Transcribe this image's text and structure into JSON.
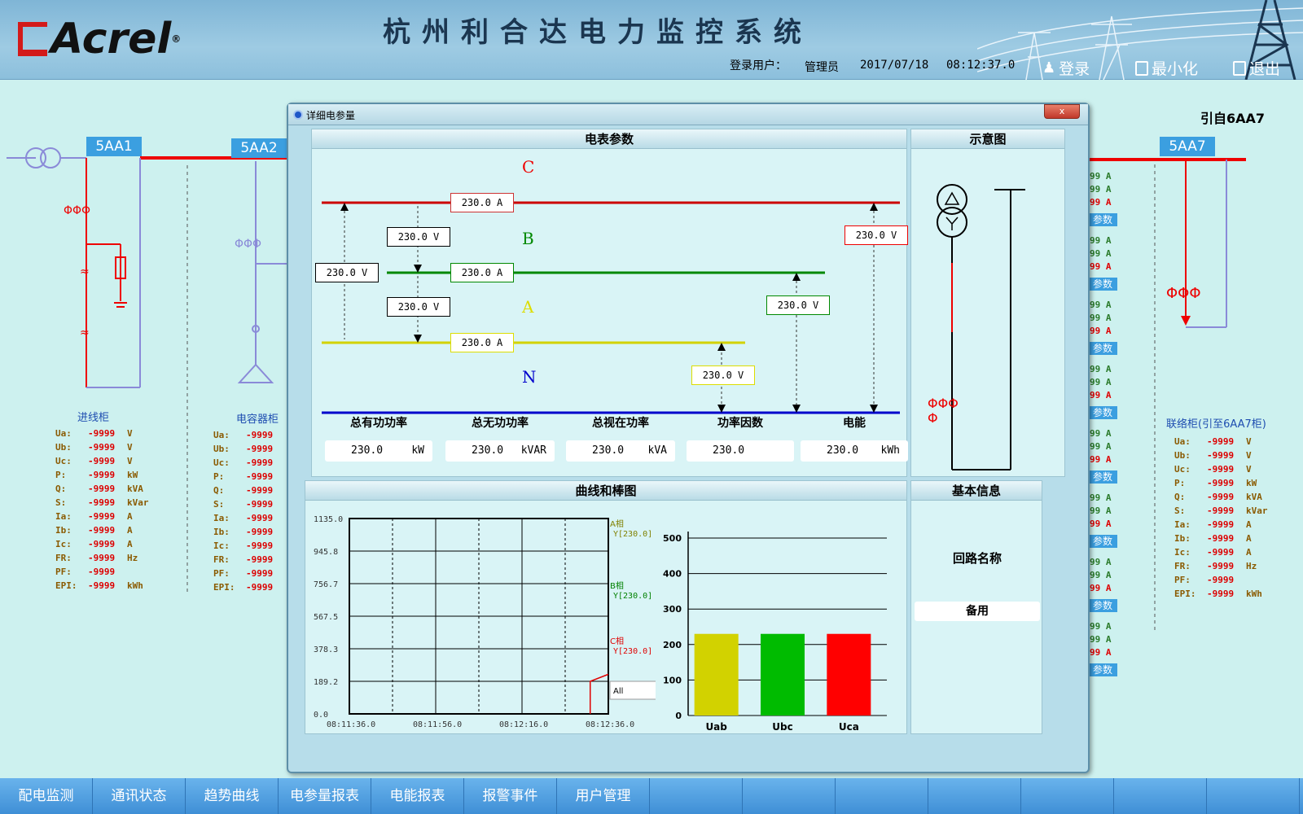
{
  "header": {
    "title": "杭州利合达电力监控系统",
    "brand": "Acrel",
    "login_user_label": "登录用户：",
    "login_user": "管理员",
    "date": "2017/07/18",
    "time": "08:12:37.0",
    "login_btn": "登录",
    "minimize_btn": "最小化",
    "exit_btn": "退出"
  },
  "left": {
    "tag1": "5AA1",
    "tag2": "5AA2",
    "cab1_label": "进线柜",
    "cab2_label": "电容器柜",
    "params1": [
      {
        "k": "Ua:",
        "v": "-9999",
        "u": "V"
      },
      {
        "k": "Ub:",
        "v": "-9999",
        "u": "V"
      },
      {
        "k": "Uc:",
        "v": "-9999",
        "u": "V"
      },
      {
        "k": "P:",
        "v": "-9999",
        "u": "kW"
      },
      {
        "k": "Q:",
        "v": "-9999",
        "u": "kVA"
      },
      {
        "k": "S:",
        "v": "-9999",
        "u": "kVar"
      },
      {
        "k": "Ia:",
        "v": "-9999",
        "u": "A"
      },
      {
        "k": "Ib:",
        "v": "-9999",
        "u": "A"
      },
      {
        "k": "Ic:",
        "v": "-9999",
        "u": "A"
      },
      {
        "k": "FR:",
        "v": "-9999",
        "u": "Hz"
      },
      {
        "k": "PF:",
        "v": "-9999",
        "u": ""
      },
      {
        "k": "EPI:",
        "v": "-9999",
        "u": "kWh"
      }
    ],
    "params2": [
      {
        "k": "Ua:",
        "v": "-9999"
      },
      {
        "k": "Ub:",
        "v": "-9999"
      },
      {
        "k": "Uc:",
        "v": "-9999"
      },
      {
        "k": "P:",
        "v": "-9999"
      },
      {
        "k": "Q:",
        "v": "-9999"
      },
      {
        "k": "S:",
        "v": "-9999"
      },
      {
        "k": "Ia:",
        "v": "-9999"
      },
      {
        "k": "Ib:",
        "v": "-9999"
      },
      {
        "k": "Ic:",
        "v": "-9999"
      },
      {
        "k": "FR:",
        "v": "-9999"
      },
      {
        "k": "PF:",
        "v": "-9999"
      },
      {
        "k": "EPI:",
        "v": "-9999"
      }
    ]
  },
  "right": {
    "source": "引自6AA7",
    "tag": "5AA7",
    "cab_label": "联络柜(引至6AA7柜)",
    "params": [
      {
        "k": "Ua:",
        "v": "-9999",
        "u": "V"
      },
      {
        "k": "Ub:",
        "v": "-9999",
        "u": "V"
      },
      {
        "k": "Uc:",
        "v": "-9999",
        "u": "V"
      },
      {
        "k": "P:",
        "v": "-9999",
        "u": "kW"
      },
      {
        "k": "Q:",
        "v": "-9999",
        "u": "kVA"
      },
      {
        "k": "S:",
        "v": "-9999",
        "u": "kVar"
      },
      {
        "k": "Ia:",
        "v": "-9999",
        "u": "A"
      },
      {
        "k": "Ib:",
        "v": "-9999",
        "u": "A"
      },
      {
        "k": "Ic:",
        "v": "-9999",
        "u": "A"
      },
      {
        "k": "FR:",
        "v": "-9999",
        "u": "Hz"
      },
      {
        "k": "PF:",
        "v": "-9999",
        "u": ""
      },
      {
        "k": "EPI:",
        "v": "-9999",
        "u": "kWh"
      }
    ],
    "strip_value": "99",
    "strip_unit": "A",
    "strip_btn": "参数"
  },
  "dialog": {
    "title": "详细电参量",
    "close": "x",
    "meter_panel": "电表参数",
    "schematic_panel": "示意图",
    "curve_panel": "曲线和棒图",
    "info_panel": "基本信息",
    "phase_c": "C",
    "phase_b": "B",
    "phase_a": "A",
    "phase_n": "N",
    "ic": "230.0  A",
    "ib": "230.0  A",
    "ia": "230.0  A",
    "uca_left": "230.0  V",
    "ubc_top": "230.0  V",
    "uab_mid": "230.0  V",
    "ucn": "230.0  V",
    "ubn": "230.0  V",
    "uan": "230.0  V",
    "sum_labels": [
      "总有功功率",
      "总无功功率",
      "总视在功率",
      "功率因数",
      "电能"
    ],
    "sum_values": [
      "230.0",
      "230.0",
      "230.0",
      "230.0",
      "230.0"
    ],
    "sum_units": [
      "kW",
      "kVAR",
      "kVA",
      "",
      "kWh"
    ],
    "loop_name_label": "回路名称",
    "loop_name_value": "备用"
  },
  "chart_data": [
    {
      "type": "line",
      "x": [
        "08:11:36.0",
        "08:11:56.0",
        "08:12:16.0",
        "08:12:36.0"
      ],
      "yticks": [
        "1135.0",
        "945.8",
        "756.7",
        "567.5",
        "378.3",
        "189.2",
        "0.0"
      ],
      "ylim": [
        0,
        1135.0
      ],
      "series": [
        {
          "name": "A相",
          "label": "Y[230.0]",
          "color": "#808000"
        },
        {
          "name": "B相",
          "label": "Y[230.0]",
          "color": "#008000"
        },
        {
          "name": "C相",
          "label": "Y[230.0]",
          "color": "#e00000",
          "points": [
            [
              0.93,
              0
            ],
            [
              0.93,
              189.2
            ],
            [
              1.0,
              230.0
            ]
          ]
        }
      ],
      "legend_all": "All"
    },
    {
      "type": "bar",
      "categories": [
        "Uab",
        "Ubc",
        "Uca"
      ],
      "values": [
        230,
        230,
        230
      ],
      "colors": [
        "#d2d200",
        "#00bb00",
        "#ff0000"
      ],
      "yticks": [
        "500",
        "400",
        "300",
        "200",
        "100",
        "0"
      ],
      "ylim": [
        0,
        500
      ]
    }
  ],
  "nav": {
    "items": [
      "配电监测",
      "通讯状态",
      "趋势曲线",
      "电参量报表",
      "电能报表",
      "报警事件",
      "用户管理"
    ]
  }
}
